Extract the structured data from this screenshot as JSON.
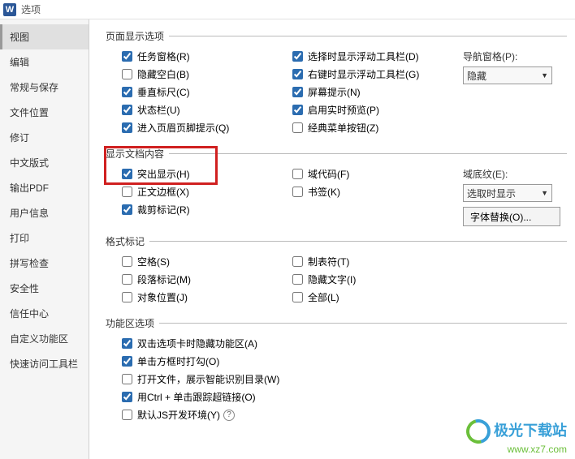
{
  "titlebar": {
    "app_glyph": "W",
    "title": "选项"
  },
  "sidebar": {
    "items": [
      {
        "label": "视图",
        "selected": true
      },
      {
        "label": "编辑"
      },
      {
        "label": "常规与保存"
      },
      {
        "label": "文件位置"
      },
      {
        "label": "修订"
      },
      {
        "label": "中文版式"
      },
      {
        "label": "输出PDF"
      },
      {
        "label": "用户信息"
      },
      {
        "label": "打印"
      },
      {
        "label": "拼写检查"
      },
      {
        "label": "安全性"
      },
      {
        "label": "信任中心"
      },
      {
        "label": "自定义功能区"
      },
      {
        "label": "快速访问工具栏"
      }
    ]
  },
  "groups": {
    "page_display": {
      "legend": "页面显示选项",
      "col1": [
        {
          "label": "任务窗格(R)",
          "checked": true
        },
        {
          "label": "隐藏空白(B)",
          "checked": false
        },
        {
          "label": "垂直标尺(C)",
          "checked": true
        },
        {
          "label": "状态栏(U)",
          "checked": true
        },
        {
          "label": "进入页眉页脚提示(Q)",
          "checked": true
        }
      ],
      "col2": [
        {
          "label": "选择时显示浮动工具栏(D)",
          "checked": true
        },
        {
          "label": "右键时显示浮动工具栏(G)",
          "checked": true
        },
        {
          "label": "屏幕提示(N)",
          "checked": true
        },
        {
          "label": "启用实时预览(P)",
          "checked": true
        },
        {
          "label": "经典菜单按钮(Z)",
          "checked": false
        }
      ],
      "side": {
        "nav_label": "导航窗格(P):",
        "nav_value": "隐藏"
      }
    },
    "doc_content": {
      "legend": "显示文档内容",
      "col1": [
        {
          "label": "突出显示(H)",
          "checked": true
        },
        {
          "label": "正文边框(X)",
          "checked": false
        },
        {
          "label": "裁剪标记(R)",
          "checked": true
        }
      ],
      "col2": [
        {
          "label": "域代码(F)",
          "checked": false
        },
        {
          "label": "书签(K)",
          "checked": false
        }
      ],
      "side": {
        "shading_label": "域底纹(E):",
        "shading_value": "选取时显示",
        "font_btn": "字体替换(O)..."
      }
    },
    "format_marks": {
      "legend": "格式标记",
      "col1": [
        {
          "label": "空格(S)",
          "checked": false
        },
        {
          "label": "段落标记(M)",
          "checked": false
        },
        {
          "label": "对象位置(J)",
          "checked": false
        }
      ],
      "col2": [
        {
          "label": "制表符(T)",
          "checked": false
        },
        {
          "label": "隐藏文字(I)",
          "checked": false
        },
        {
          "label": "全部(L)",
          "checked": false
        }
      ]
    },
    "ribbon": {
      "legend": "功能区选项",
      "items": [
        {
          "label": "双击选项卡时隐藏功能区(A)",
          "checked": true
        },
        {
          "label": "单击方框时打勾(O)",
          "checked": true
        },
        {
          "label": "打开文件，展示智能识别目录(W)",
          "checked": false
        },
        {
          "label": "用Ctrl + 单击跟踪超链接(O)",
          "checked": true
        },
        {
          "label": "默认JS开发环境(Y)",
          "checked": false,
          "help": true
        }
      ]
    }
  },
  "watermark": {
    "line1": "极光下载站",
    "line2": "www.xz7.com"
  }
}
